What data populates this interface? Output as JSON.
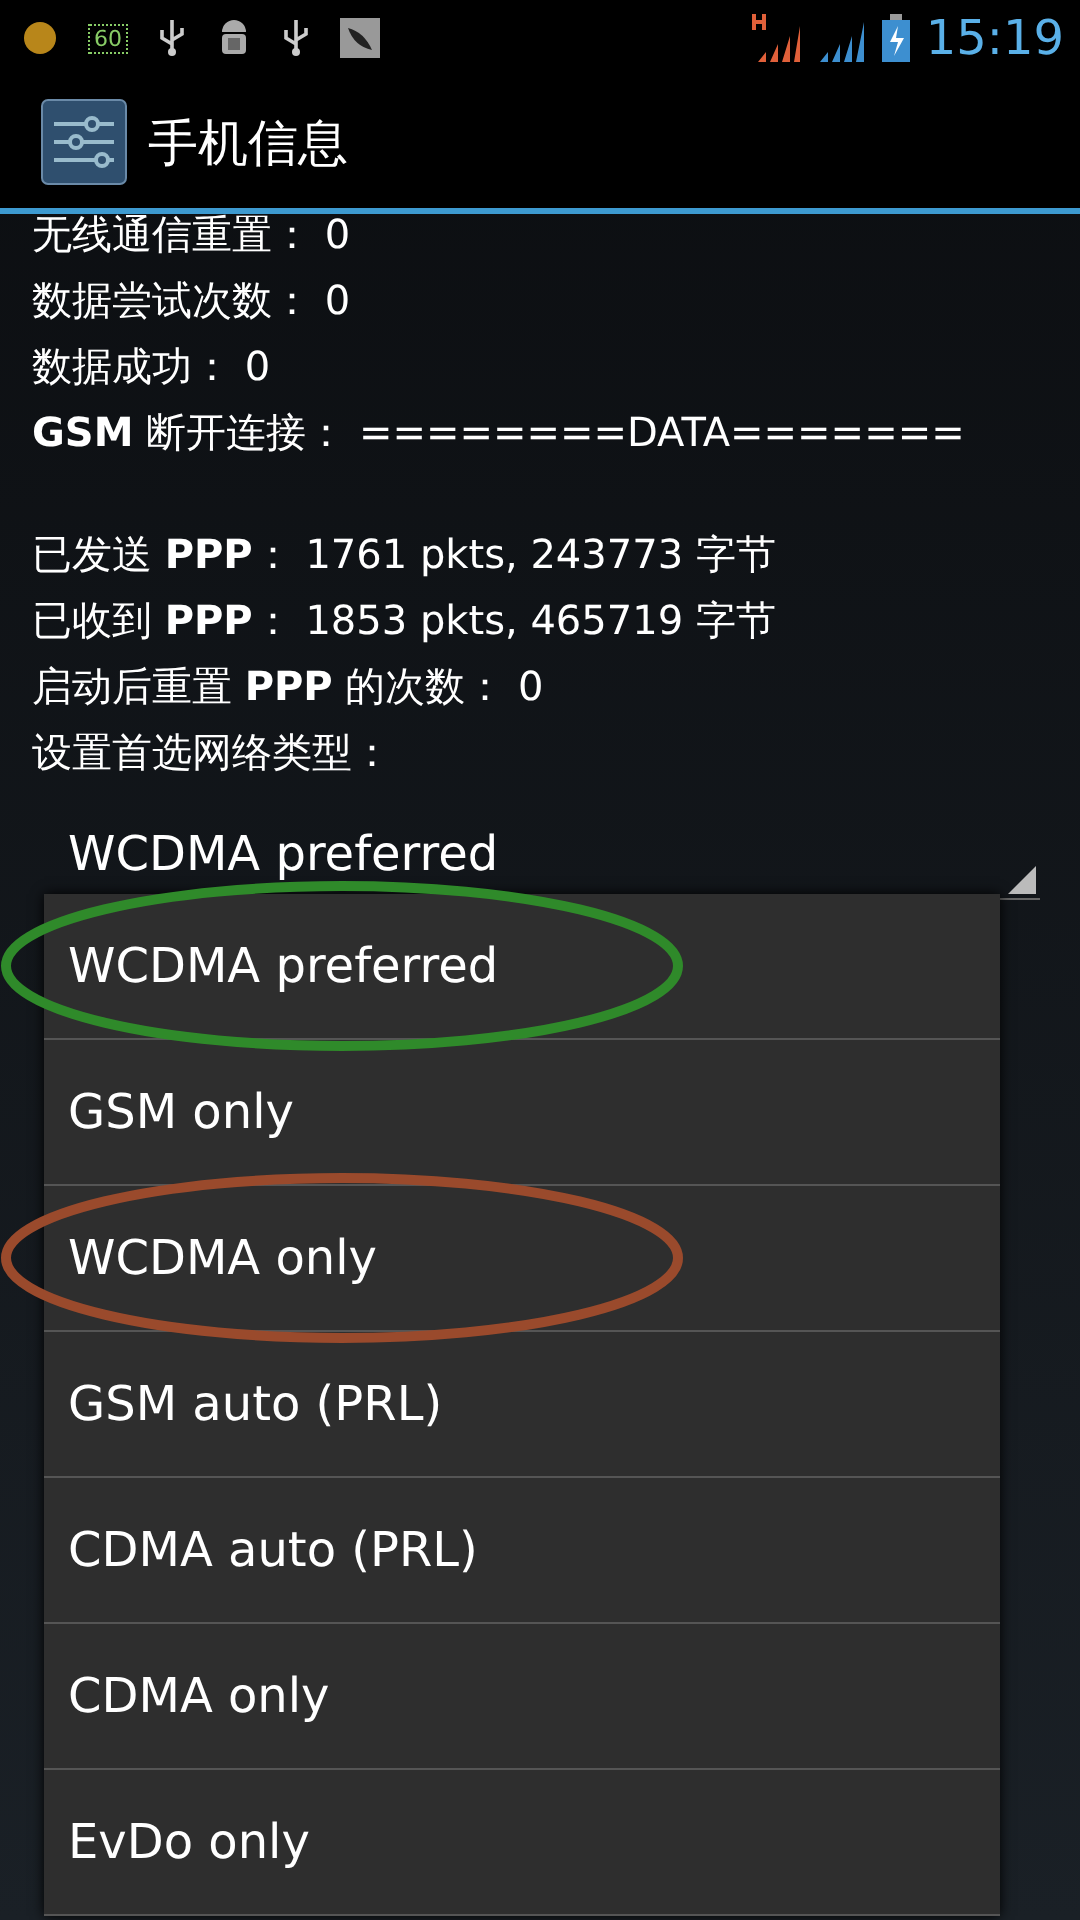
{
  "status_bar": {
    "time": "15:19",
    "badge": "60"
  },
  "title": "手机信息",
  "info_groups": [
    [
      {
        "text": "无线通信重置： 0"
      },
      {
        "text": "数据尝试次数： 0"
      },
      {
        "text": "数据成功： 0"
      },
      {
        "text": "**GSM** 断开连接： ========DATA======="
      }
    ],
    [
      {
        "text": "已发送 **PPP**： 1761 pkts, 243773 字节"
      },
      {
        "text": "已收到 **PPP**： 1853 pkts, 465719 字节"
      },
      {
        "text": "启动后重置 **PPP** 的次数： 0"
      },
      {
        "text": "设置首选网络类型："
      }
    ]
  ],
  "spinner": {
    "value": "WCDMA preferred"
  },
  "dropdown_items": [
    {
      "label": "WCDMA preferred",
      "color": "#2f8a2a"
    },
    {
      "label": "GSM only"
    },
    {
      "label": "WCDMA only",
      "color": "#9a4a2c"
    },
    {
      "label": "GSM auto (PRL)"
    },
    {
      "label": "CDMA auto (PRL)"
    },
    {
      "label": "CDMA only"
    },
    {
      "label": "EvDo only"
    }
  ]
}
